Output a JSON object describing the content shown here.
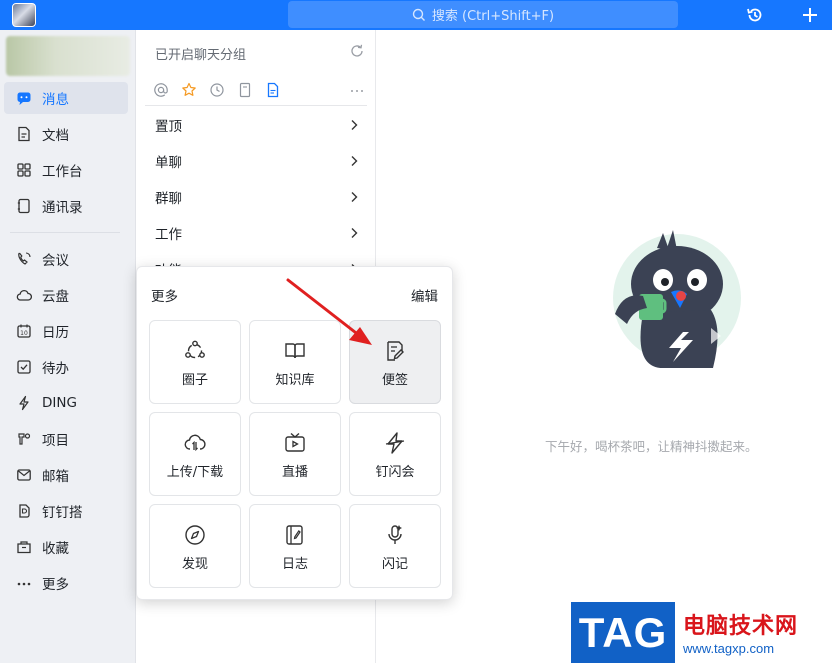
{
  "topbar": {
    "search_placeholder": "搜索 (Ctrl+Shift+F)"
  },
  "sidebar": {
    "items": [
      {
        "label": "消息",
        "icon": "message-icon",
        "active": true
      },
      {
        "label": "文档",
        "icon": "document-icon"
      },
      {
        "label": "工作台",
        "icon": "workbench-icon"
      },
      {
        "label": "通讯录",
        "icon": "contacts-icon"
      },
      {
        "label": "会议",
        "icon": "meeting-icon"
      },
      {
        "label": "云盘",
        "icon": "cloud-drive-icon"
      },
      {
        "label": "日历",
        "icon": "calendar-icon"
      },
      {
        "label": "待办",
        "icon": "todo-icon"
      },
      {
        "label": "DING",
        "icon": "ding-icon"
      },
      {
        "label": "项目",
        "icon": "project-icon"
      },
      {
        "label": "邮箱",
        "icon": "mail-icon"
      },
      {
        "label": "钉钉搭",
        "icon": "dingda-icon"
      },
      {
        "label": "收藏",
        "icon": "favorites-icon"
      },
      {
        "label": "更多",
        "icon": "more-icon"
      }
    ]
  },
  "middle": {
    "group_status": "已开启聊天分组",
    "categories": [
      "置顶",
      "单聊",
      "群聊",
      "工作",
      "功能"
    ]
  },
  "popup": {
    "title": "更多",
    "edit": "编辑",
    "tiles": [
      {
        "label": "圈子",
        "icon": "circle-icon"
      },
      {
        "label": "知识库",
        "icon": "knowledge-base-icon"
      },
      {
        "label": "便签",
        "icon": "note-icon",
        "highlighted": true
      },
      {
        "label": "上传/下载",
        "icon": "upload-download-icon"
      },
      {
        "label": "直播",
        "icon": "live-icon"
      },
      {
        "label": "钉闪会",
        "icon": "flash-meeting-icon"
      },
      {
        "label": "发现",
        "icon": "discover-icon"
      },
      {
        "label": "日志",
        "icon": "log-icon"
      },
      {
        "label": "闪记",
        "icon": "flash-note-icon"
      }
    ]
  },
  "main": {
    "greeting": "下午好，喝杯茶吧，让精神抖擞起来。"
  },
  "watermark": {
    "tag": "TAG",
    "site_name": "电脑技术网",
    "url": "www.tagxp.com"
  },
  "colors": {
    "accent": "#1677ff",
    "sidebar_bg": "#eef0f4",
    "annotation_arrow": "#e02020"
  }
}
